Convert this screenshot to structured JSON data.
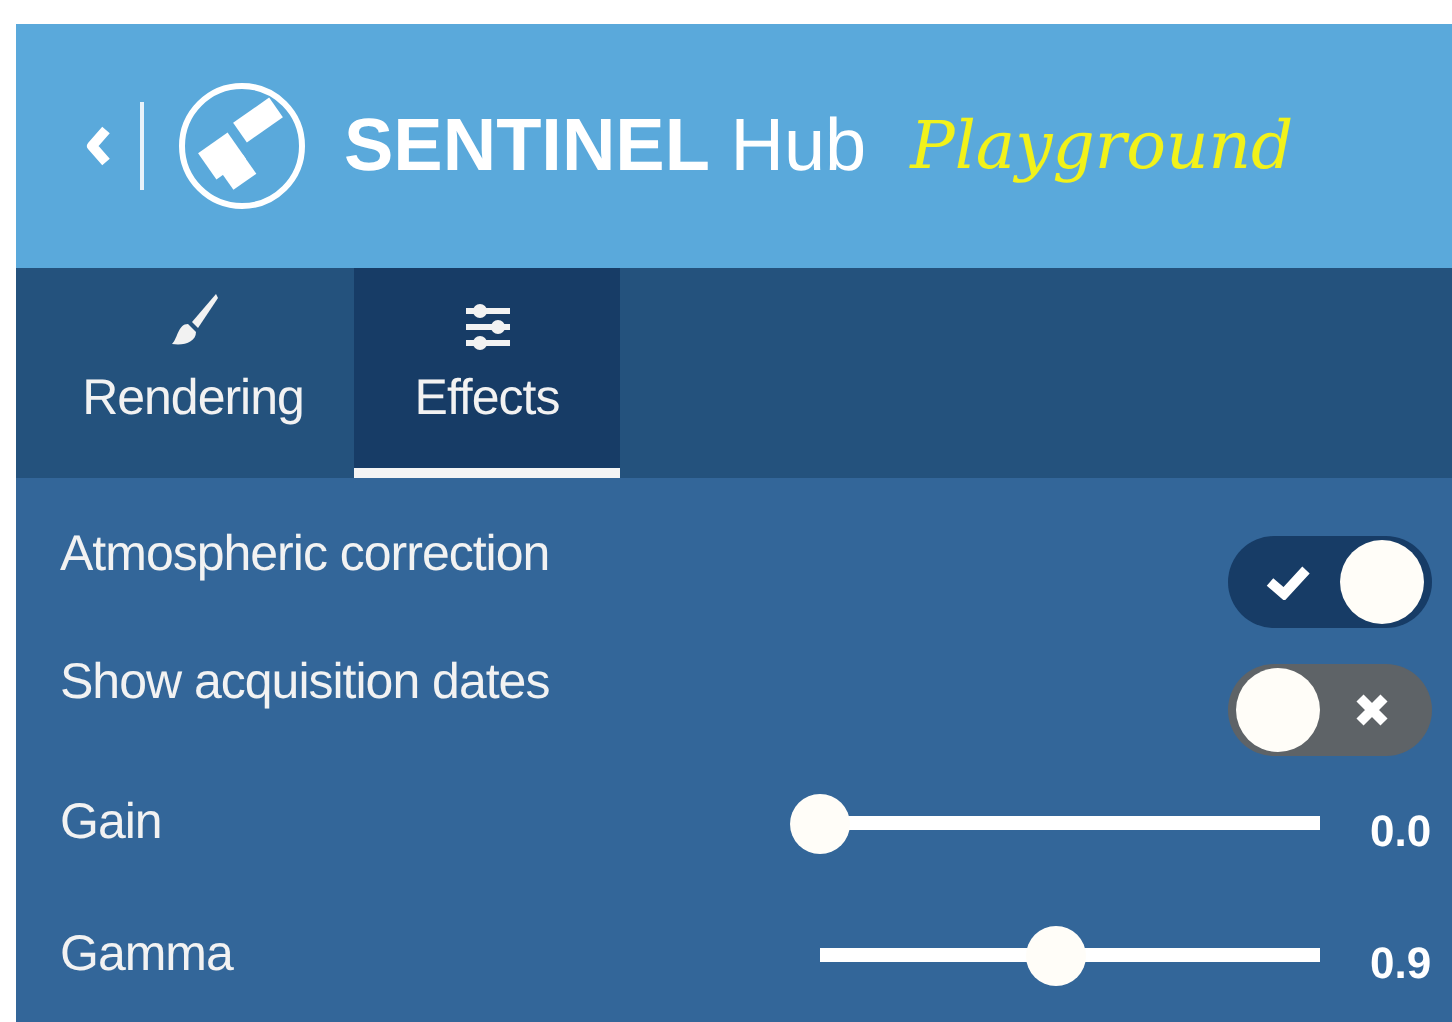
{
  "header": {
    "brand_bold": "SENTINEL",
    "brand_light": "Hub",
    "product": "Playground"
  },
  "tabs": [
    {
      "label": "Rendering",
      "kind": "brush",
      "selected": false
    },
    {
      "label": "Effects",
      "kind": "sliders",
      "selected": true
    }
  ],
  "settings": [
    {
      "kind": "toggle",
      "label": "Atmospheric correction",
      "on": true
    },
    {
      "kind": "toggle",
      "label": "Show acquisition dates",
      "on": false
    },
    {
      "kind": "slider",
      "label": "Gain",
      "level": 0,
      "reading": "0.0"
    },
    {
      "kind": "slider",
      "label": "Gamma",
      "level": 0.47,
      "reading": "0.9"
    }
  ]
}
